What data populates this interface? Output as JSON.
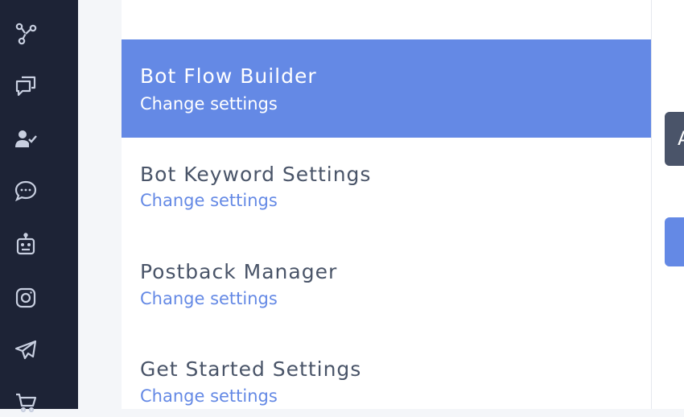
{
  "sidebar": {
    "icons": [
      {
        "name": "flow-icon"
      },
      {
        "name": "chat-bubbles-icon"
      },
      {
        "name": "user-check-icon"
      },
      {
        "name": "comment-dots-icon"
      },
      {
        "name": "robot-icon"
      },
      {
        "name": "instagram-icon"
      },
      {
        "name": "telegram-icon"
      },
      {
        "name": "cart-icon"
      }
    ]
  },
  "menu": {
    "items": [
      {
        "title": "Bot Flow Builder",
        "subtitle": "Change settings",
        "active": true
      },
      {
        "title": "Bot Keyword Settings",
        "subtitle": "Change settings",
        "active": false
      },
      {
        "title": "Postback Manager",
        "subtitle": "Change settings",
        "active": false
      },
      {
        "title": "Get Started Settings",
        "subtitle": "Change settings",
        "active": false
      }
    ]
  },
  "right": {
    "dark_button_label": "A"
  },
  "colors": {
    "sidebar_bg": "#1d2336",
    "accent": "#6489e5",
    "title_text": "#495468",
    "dark_button": "#4a5469"
  }
}
